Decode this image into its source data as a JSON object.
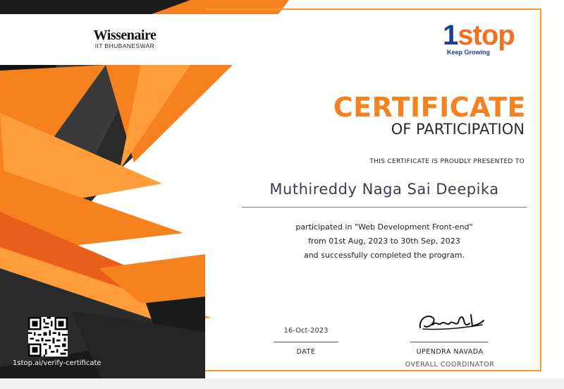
{
  "issuer_logo": {
    "brand": "Wissenaire",
    "subtitle": "IIT BHUBANESWAR"
  },
  "partner_logo": {
    "brand_digit": "1",
    "brand_word": "stop",
    "tagline": "Keep Growing"
  },
  "certificate": {
    "title": "CERTIFICATE",
    "subtitle": "OF PARTICIPATION",
    "presented_to": "THIS CERTIFICATE IS PROUDLY PRESENTED TO",
    "recipient": "Muthireddy Naga Sai Deepika",
    "body_line1": "participated in \"Web Development Front-end\"",
    "body_line2": "from 01st Aug, 2023 to 30th Sep, 2023",
    "body_line3": "and successfully completed the program."
  },
  "date_block": {
    "value": "16-Oct-2023",
    "label": "DATE"
  },
  "signatory": {
    "name": "UPENDRA NAVADA",
    "role": "OVERALL COORDINATOR"
  },
  "verification": {
    "url_text": "1stop.ai/verify-certificate"
  },
  "colors": {
    "accent": "#f5821f",
    "dark": "#1a1a1a",
    "brand_blue": "#1e3d8f",
    "border": "#f39a2f"
  }
}
